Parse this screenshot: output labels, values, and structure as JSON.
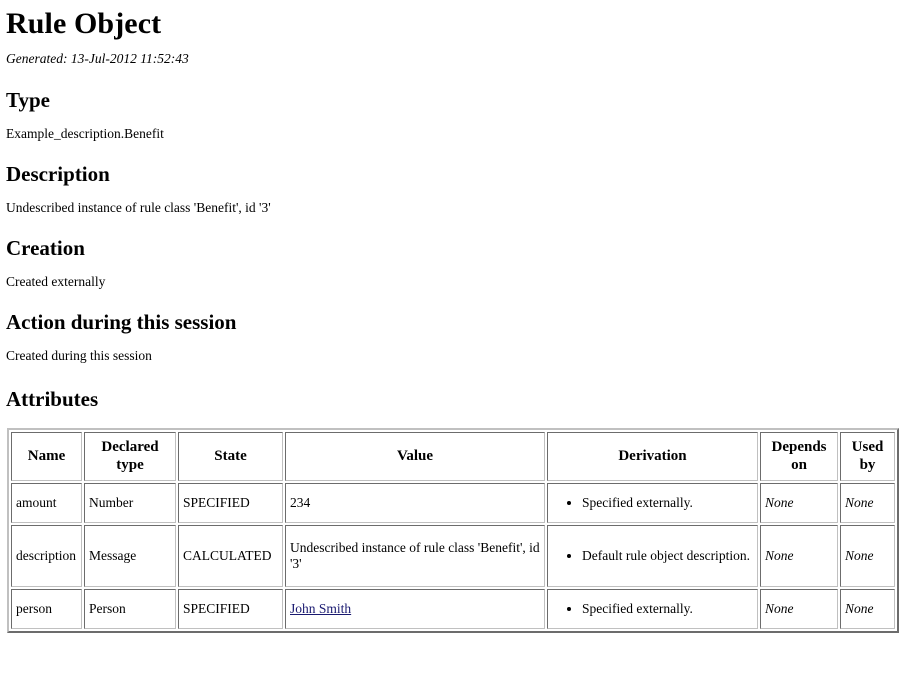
{
  "document": {
    "title": "Rule Object",
    "generated": "Generated: 13-Jul-2012 11:52:43"
  },
  "sections": {
    "type": {
      "heading": "Type",
      "text": "Example_description.Benefit"
    },
    "description": {
      "heading": "Description",
      "text": "Undescribed instance of rule class 'Benefit', id '3'"
    },
    "creation": {
      "heading": "Creation",
      "text": "Created externally"
    },
    "action": {
      "heading": "Action during this session",
      "text": "Created during this session"
    },
    "attributes": {
      "heading": "Attributes"
    }
  },
  "table": {
    "columns": [
      "Name",
      "Declared type",
      "State",
      "Value",
      "Derivation",
      "Depends on",
      "Used by"
    ],
    "rows": [
      {
        "name": "amount",
        "declared_type": "Number",
        "state": "SPECIFIED",
        "value": "234",
        "value_is_link": false,
        "derivation": "Specified externally.",
        "depends_on": "None",
        "used_by": "None"
      },
      {
        "name": "description",
        "declared_type": "Message",
        "state": "CALCULATED",
        "value": "Undescribed instance of rule class 'Benefit', id '3'",
        "value_is_link": false,
        "derivation": "Default rule object description.",
        "depends_on": "None",
        "used_by": "None"
      },
      {
        "name": "person",
        "declared_type": "Person",
        "state": "SPECIFIED",
        "value": "John Smith",
        "value_is_link": true,
        "derivation": "Specified externally.",
        "depends_on": "None",
        "used_by": "None"
      }
    ]
  },
  "colors": {
    "link": "#191970",
    "text": "#000000",
    "background": "#ffffff",
    "table_border": "#c0c0c0"
  }
}
